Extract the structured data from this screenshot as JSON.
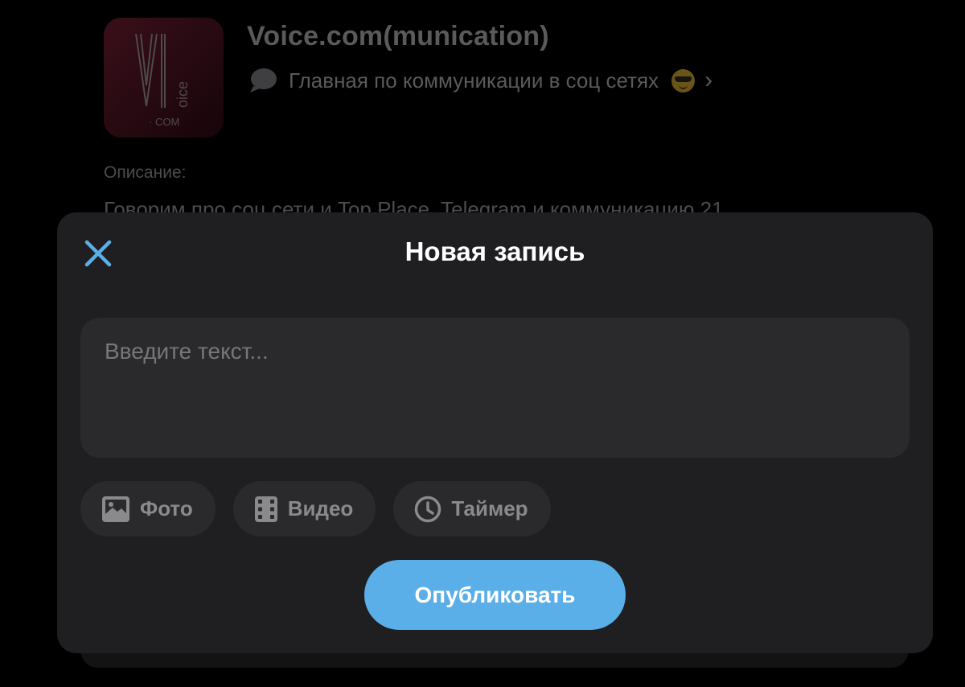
{
  "channel": {
    "avatar_text_main": "V",
    "avatar_text_side": "oice",
    "avatar_text_bottom": "· COM",
    "title": "Voice.com(munication)",
    "status_text": "Главная по коммуникации в соц сетях",
    "status_icon": "speech-bubble-icon",
    "status_emoji": "sunglasses-emoji",
    "description_label": "Описание:",
    "description_text": "Говорим про соц сети и Top Place, Telegram и коммуникацию 21"
  },
  "modal": {
    "title": "Новая запись",
    "close_icon": "close-icon",
    "text_placeholder": "Введите текст...",
    "attachments": [
      {
        "label": "Фото",
        "icon": "image-icon"
      },
      {
        "label": "Видео",
        "icon": "film-icon"
      },
      {
        "label": "Таймер",
        "icon": "clock-icon"
      }
    ],
    "publish_label": "Опубликовать"
  },
  "colors": {
    "accent": "#5aafe8",
    "modal_bg": "#1f1f21",
    "field_bg": "#2a2a2c",
    "page_bg": "#000000"
  }
}
